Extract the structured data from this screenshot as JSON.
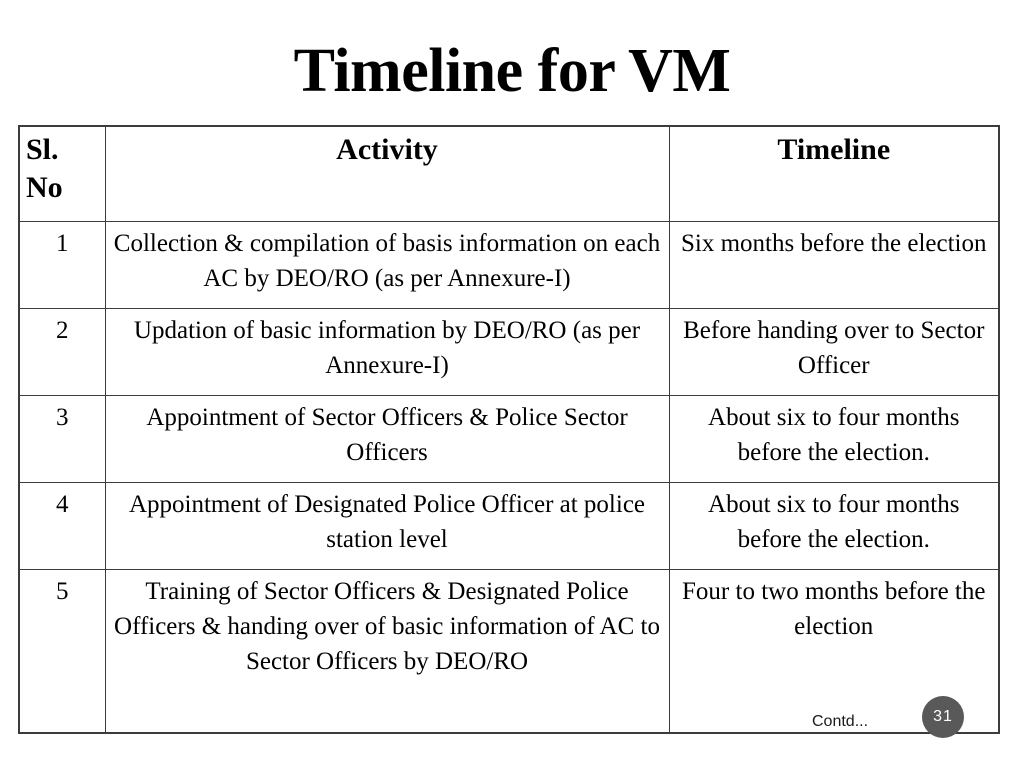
{
  "slide": {
    "title": "Timeline for VM"
  },
  "table": {
    "headers": {
      "sl_no": "Sl. No",
      "activity": "Activity",
      "timeline": "Timeline"
    },
    "rows": [
      {
        "sl_no": "1",
        "activity": "Collection & compilation of basis information on each AC by DEO/RO (as per Annexure-I)",
        "timeline": "Six months before the election"
      },
      {
        "sl_no": "2",
        "activity": "Updation of basic information by DEO/RO (as per Annexure-I)",
        "timeline": "Before handing over to Sector Officer"
      },
      {
        "sl_no": "3",
        "activity": "Appointment of Sector Officers & Police Sector Officers",
        "timeline": "About six to four months before the election."
      },
      {
        "sl_no": "4",
        "activity": "Appointment of Designated Police Officer at police station level",
        "timeline": "About six to four months before the election."
      },
      {
        "sl_no": "5",
        "activity": "Training of Sector Officers & Designated Police Officers & handing over of basic information of AC to Sector Officers by DEO/RO",
        "timeline": "Four to two months before the election"
      }
    ]
  },
  "footer": {
    "contd_note": "Contd...",
    "page_number": "31"
  },
  "colors": {
    "border": "#3c3c3c",
    "badge_background": "#595959",
    "badge_text": "#ffffff",
    "text": "#000000",
    "background": "#ffffff"
  }
}
